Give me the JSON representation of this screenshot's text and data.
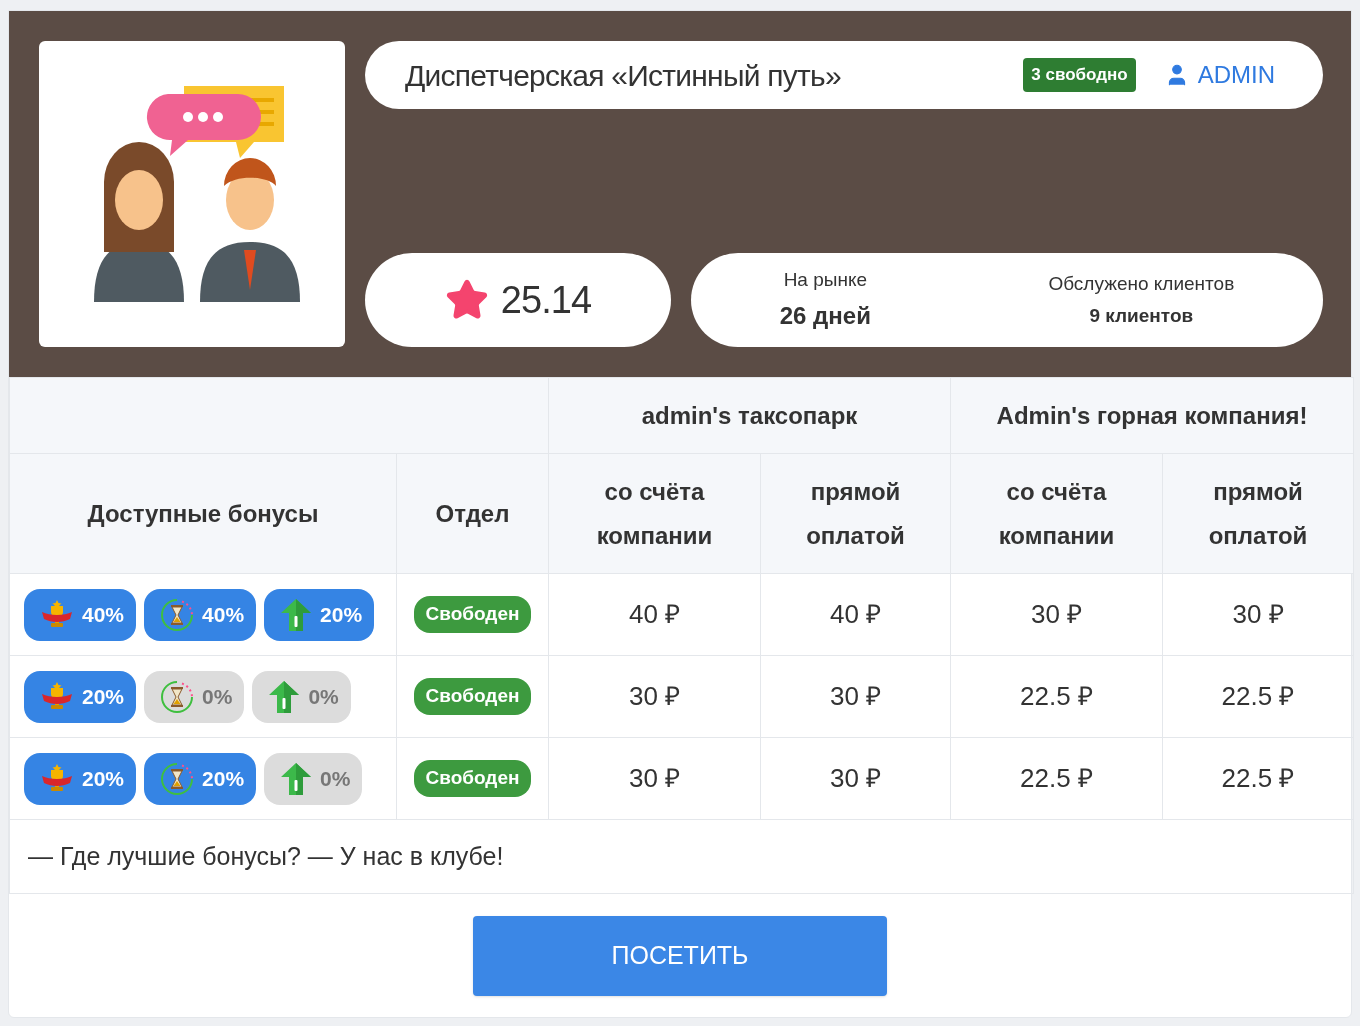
{
  "header": {
    "title": "Диспетчерская «Истинный путь»",
    "free_badge": "3 свободно",
    "user": "ADMIN",
    "rating": "25.14",
    "stats": [
      {
        "label": "На рынке",
        "value": "26 дней"
      },
      {
        "label": "Обслужено клиентов",
        "value": "9 клиентов"
      }
    ]
  },
  "table": {
    "groups": [
      "admin's таксопарк",
      "Admin's горная компания!"
    ],
    "columns": [
      "Доступные бонусы",
      "Отдел",
      "со счёта компании",
      "прямой оплатой",
      "со счёта компании",
      "прямой оплатой"
    ],
    "rows": [
      {
        "bonuses": [
          {
            "kind": "trophy",
            "value": "40%",
            "active": true
          },
          {
            "kind": "hourglass",
            "value": "40%",
            "active": true
          },
          {
            "kind": "arrow",
            "value": "20%",
            "active": true
          }
        ],
        "status": "Свободен",
        "prices": [
          "40 ₽",
          "40 ₽",
          "30 ₽",
          "30 ₽"
        ]
      },
      {
        "bonuses": [
          {
            "kind": "trophy",
            "value": "20%",
            "active": true
          },
          {
            "kind": "hourglass",
            "value": "0%",
            "active": false
          },
          {
            "kind": "arrow",
            "value": "0%",
            "active": false
          }
        ],
        "status": "Свободен",
        "prices": [
          "30 ₽",
          "30 ₽",
          "22.5 ₽",
          "22.5 ₽"
        ]
      },
      {
        "bonuses": [
          {
            "kind": "trophy",
            "value": "20%",
            "active": true
          },
          {
            "kind": "hourglass",
            "value": "20%",
            "active": true
          },
          {
            "kind": "arrow",
            "value": "0%",
            "active": false
          }
        ],
        "status": "Свободен",
        "prices": [
          "30 ₽",
          "30 ₽",
          "22.5 ₽",
          "22.5 ₽"
        ]
      }
    ]
  },
  "footer": {
    "slogan": "— Где лучшие бонусы? — У нас в клубе!",
    "button": "ПОСЕТИТЬ"
  }
}
